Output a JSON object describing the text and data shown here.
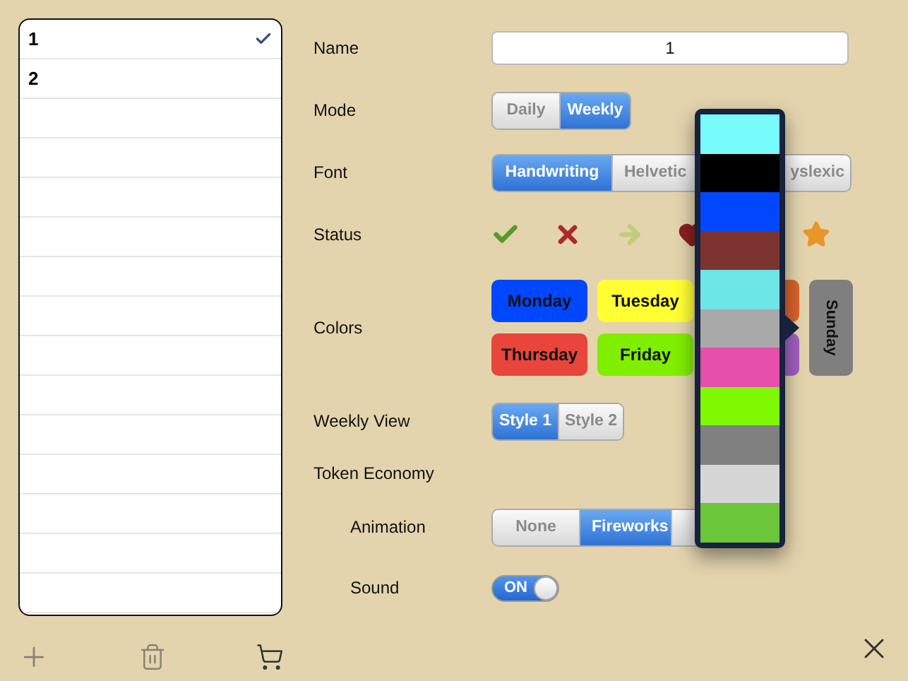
{
  "list": {
    "items": [
      {
        "label": "1",
        "selected": true
      },
      {
        "label": "2",
        "selected": false
      }
    ]
  },
  "settings": [
    {
      "kind": "text",
      "label": "Name",
      "value": "1"
    },
    {
      "kind": "segmented",
      "label": "Mode",
      "segments": [
        {
          "label": "Daily",
          "selected": false
        },
        {
          "label": "Weekly",
          "selected": true
        }
      ]
    },
    {
      "kind": "segmented",
      "label": "Font",
      "segments": [
        {
          "label": "Handwriting",
          "selected": true
        },
        {
          "label": "Helvetic",
          "selected": false
        },
        {
          "label": "yslexic",
          "selected": false
        }
      ]
    },
    {
      "kind": "icons",
      "label": "Status",
      "icons": [
        {
          "kind": "check"
        },
        {
          "kind": "cross"
        },
        {
          "kind": "arrow"
        },
        {
          "kind": "heart"
        },
        {
          "kind": "star"
        }
      ]
    },
    {
      "kind": "colors",
      "label": "Colors",
      "days": [
        {
          "label": "Monday",
          "color": "#0047ff"
        },
        {
          "label": "Tuesday",
          "color": "#ffff33"
        },
        {
          "color": "#d9642a"
        },
        {
          "label": "Thursday",
          "color": "#e8453c"
        },
        {
          "label": "Friday",
          "color": "#80ee00"
        },
        {
          "color": "#a060c0"
        }
      ],
      "side_day": {
        "label": "Sunday",
        "color": "#7f7f7f"
      }
    },
    {
      "kind": "segmented",
      "label": "Weekly View",
      "segments": [
        {
          "label": "Style 1",
          "selected": true
        },
        {
          "label": "Style 2",
          "selected": false
        }
      ]
    },
    {
      "kind": "heading",
      "label": "Token Economy",
      "children": [
        {
          "kind": "segmented",
          "label": "Animation",
          "segments": [
            {
              "label": "None",
              "selected": false
            },
            {
              "label": "Fireworks",
              "selected": true
            },
            {
              "selected": false
            }
          ]
        },
        {
          "kind": "toggle",
          "label": "Sound",
          "on": true,
          "text": "ON"
        }
      ]
    }
  ],
  "popover": {
    "swatches": [
      {
        "color": "#77fbfb"
      },
      {
        "color": "#000000"
      },
      {
        "color": "#0047ff"
      },
      {
        "color": "#7d3330"
      },
      {
        "color": "#6ce6e6"
      },
      {
        "color": "#a9a9a9"
      },
      {
        "color": "#e64fac"
      },
      {
        "color": "#7ff902"
      },
      {
        "color": "#808080"
      },
      {
        "color": "#d6d6d6"
      },
      {
        "color": "#6cc63a"
      }
    ]
  }
}
